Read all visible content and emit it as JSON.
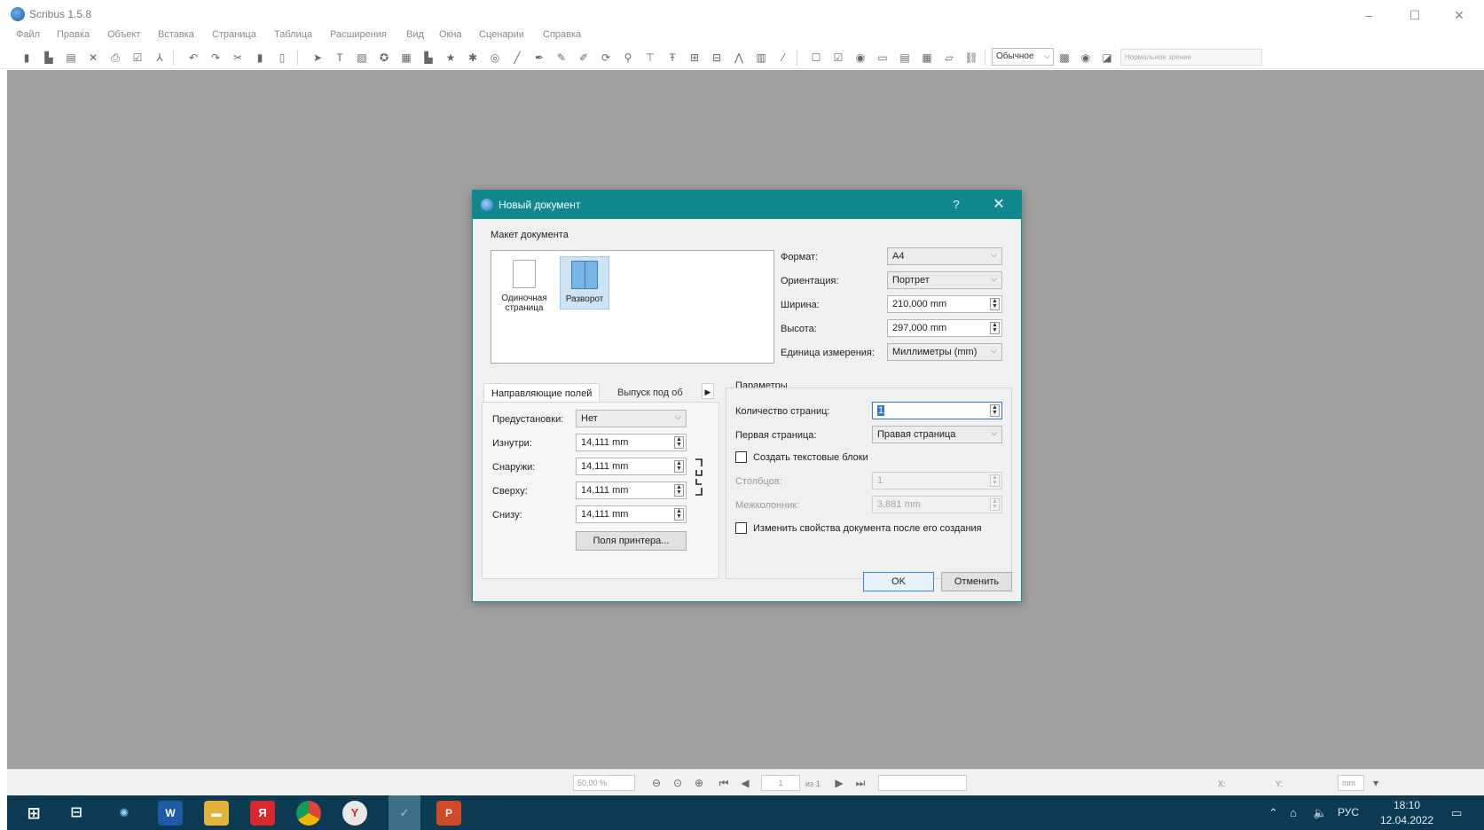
{
  "window": {
    "title": "Scribus 1.5.8",
    "controls": {
      "minimize": "–",
      "maximize": "☐",
      "close": "✕"
    }
  },
  "menu": [
    "Файл",
    "Правка",
    "Объект",
    "Вставка",
    "Страница",
    "Таблица",
    "Расширения",
    "Вид",
    "Окна",
    "Сценарии",
    "Справка"
  ],
  "toolbar": {
    "mode_select": "Обычное",
    "render_select": "Нормальное зрение"
  },
  "dialog": {
    "title": "Новый документ",
    "help": "?",
    "close": "✕",
    "layout_group": "Макет документа",
    "layout_options": [
      {
        "label": "Одиночная страница",
        "selected": false
      },
      {
        "label": "Разворот",
        "selected": true
      }
    ],
    "format": {
      "label": "Формат:",
      "value": "A4"
    },
    "orientation": {
      "label": "Ориентация:",
      "value": "Портрет"
    },
    "width": {
      "label": "Ширина:",
      "value": "210,000 mm"
    },
    "height": {
      "label": "Высота:",
      "value": "297,000 mm"
    },
    "units": {
      "label": "Единица измерения:",
      "value": "Миллиметры (mm)"
    },
    "tabs": [
      "Направляющие полей",
      "Выпуск под об"
    ],
    "presets": {
      "label": "Предустановки:",
      "value": "Нет"
    },
    "inside": {
      "label": "Изнутри:",
      "value": "14,111 mm"
    },
    "outside": {
      "label": "Снаружи:",
      "value": "14,111 mm"
    },
    "top": {
      "label": "Сверху:",
      "value": "14,111 mm"
    },
    "bottom": {
      "label": "Снизу:",
      "value": "14,111 mm"
    },
    "printer_margins_button": "Поля принтера...",
    "params_group": "Параметры",
    "page_count": {
      "label": "Количество страниц:",
      "value": "1"
    },
    "first_page": {
      "label": "Первая страница:",
      "value": "Правая страница"
    },
    "text_frames_checkbox": "Создать текстовые блоки",
    "columns": {
      "label": "Столбцов:",
      "value": "1"
    },
    "gap": {
      "label": "Межколонник:",
      "value": "3,881 mm"
    },
    "open_props_checkbox": "Изменить свойства документа после его создания",
    "ok_button": "OK",
    "cancel_button": "Отменить"
  },
  "statusbar": {
    "zoom": "50,00 %",
    "page": "1",
    "page_of": "из 1",
    "x_label": "X:",
    "y_label": "Y:",
    "unit": "mm"
  },
  "taskbar": {
    "lang": "РУС",
    "time": "18:10",
    "date": "12.04.2022"
  }
}
